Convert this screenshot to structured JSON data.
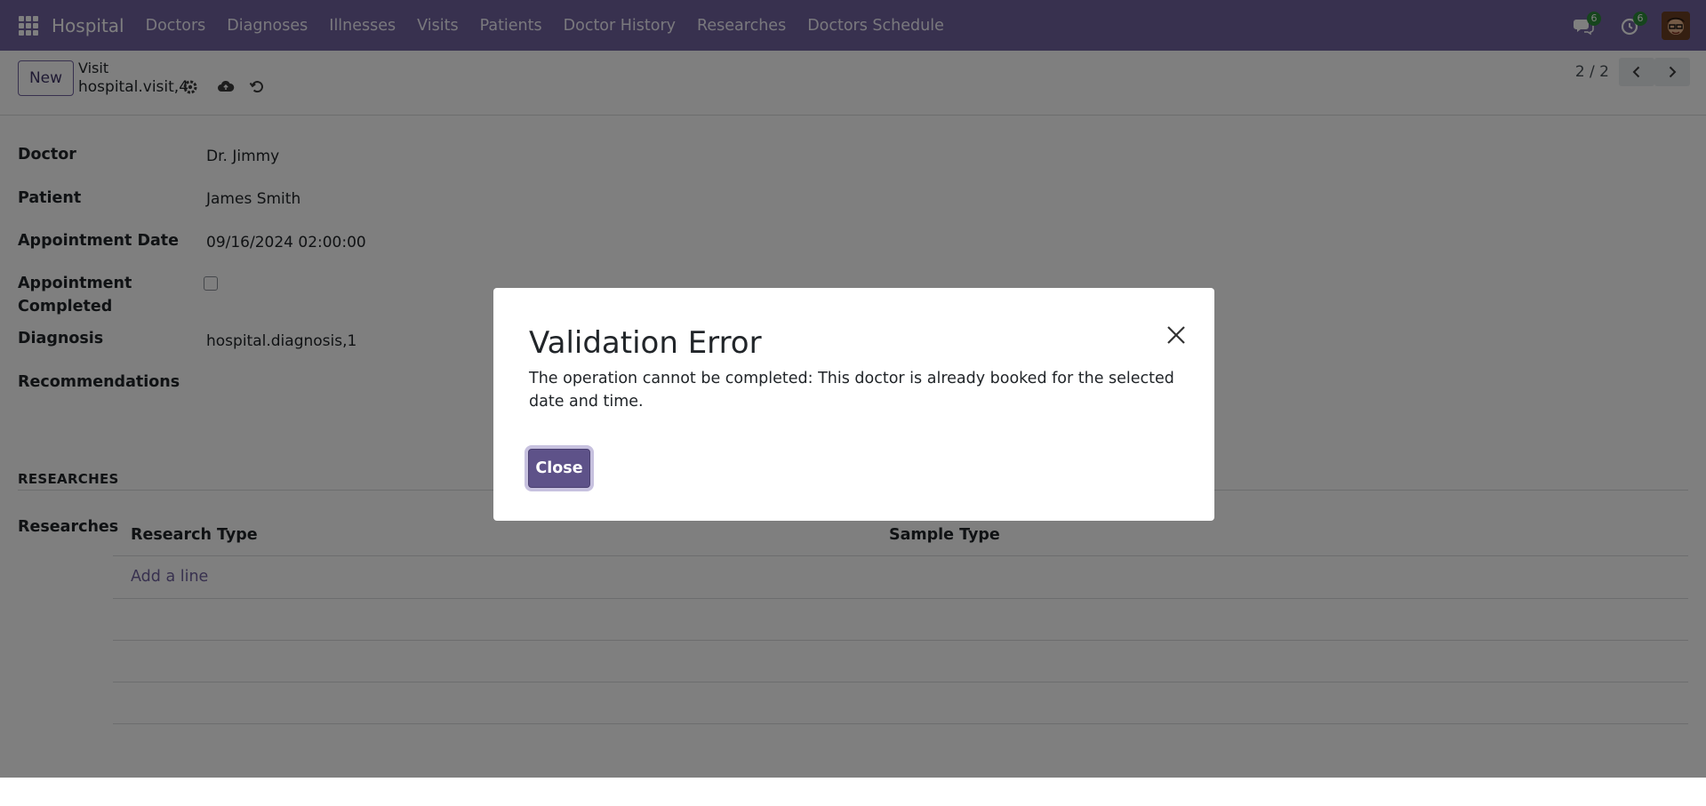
{
  "navbar": {
    "brand": "Hospital",
    "menu": [
      "Doctors",
      "Diagnoses",
      "Illnesses",
      "Visits",
      "Patients",
      "Doctor History",
      "Researches",
      "Doctors Schedule"
    ],
    "messages_count": "6",
    "activities_count": "6",
    "accent_color": "#71639e"
  },
  "control_panel": {
    "new_label": "New",
    "breadcrumb_parent": "Visit",
    "breadcrumb_record": "hospital.visit,4",
    "pager": "2 / 2"
  },
  "form": {
    "fields": [
      {
        "label": "Doctor",
        "value": "Dr. Jimmy"
      },
      {
        "label": "Patient",
        "value": "James Smith"
      },
      {
        "label": "Appointment Date",
        "value": "09/16/2024 02:00:00"
      },
      {
        "label": "Appointment Completed",
        "value": ""
      },
      {
        "label": "Diagnosis",
        "value": "hospital.diagnosis,1"
      },
      {
        "label": "Recommendations",
        "value": ""
      }
    ],
    "section_title": "RESEARCHES",
    "researches_label": "Researches",
    "table_headers": [
      "Research Type",
      "Sample Type"
    ],
    "add_line": "Add a line"
  },
  "dialog": {
    "title": "Validation Error",
    "message": "The operation cannot be completed: This doctor is already booked for the selected date and time.",
    "close_button": "Close"
  }
}
